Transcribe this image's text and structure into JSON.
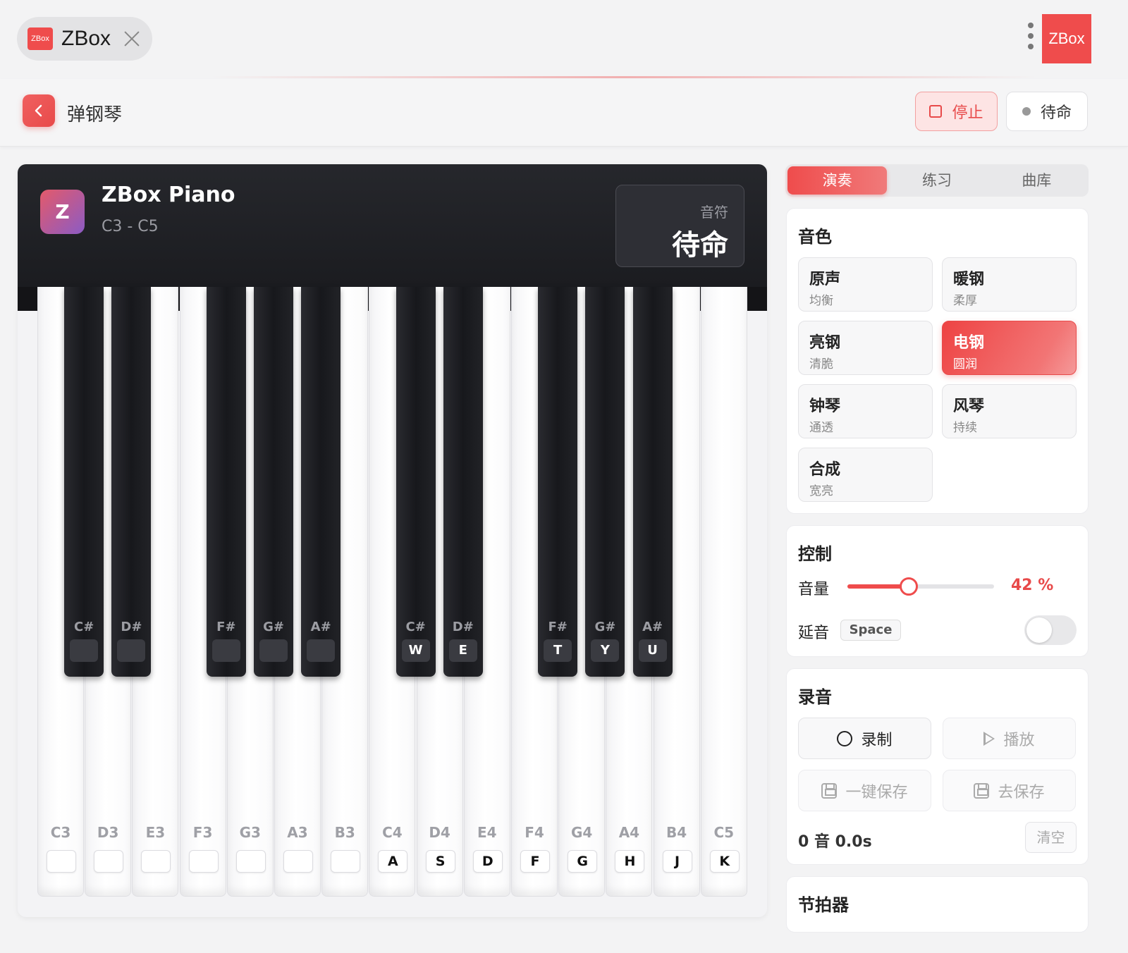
{
  "titlebar": {
    "tab_logo": "ZBox",
    "tab_title": "ZBox",
    "brand_button": "ZBox"
  },
  "header": {
    "title": "弹钢琴",
    "stop_label": "停止",
    "status_label": "待命"
  },
  "piano": {
    "name": "ZBox Piano",
    "range": "C3 - C5",
    "note_label": "音符",
    "note_value": "待命",
    "white_keys": [
      {
        "note": "C3",
        "key": ""
      },
      {
        "note": "D3",
        "key": ""
      },
      {
        "note": "E3",
        "key": ""
      },
      {
        "note": "F3",
        "key": ""
      },
      {
        "note": "G3",
        "key": ""
      },
      {
        "note": "A3",
        "key": ""
      },
      {
        "note": "B3",
        "key": ""
      },
      {
        "note": "C4",
        "key": "A"
      },
      {
        "note": "D4",
        "key": "S"
      },
      {
        "note": "E4",
        "key": "D"
      },
      {
        "note": "F4",
        "key": "F"
      },
      {
        "note": "G4",
        "key": "G"
      },
      {
        "note": "A4",
        "key": "H"
      },
      {
        "note": "B4",
        "key": "J"
      },
      {
        "note": "C5",
        "key": "K"
      }
    ],
    "black_keys": [
      {
        "note": "C#",
        "key": "",
        "after": 0
      },
      {
        "note": "D#",
        "key": "",
        "after": 1
      },
      {
        "note": "F#",
        "key": "",
        "after": 3
      },
      {
        "note": "G#",
        "key": "",
        "after": 4
      },
      {
        "note": "A#",
        "key": "",
        "after": 5
      },
      {
        "note": "C#",
        "key": "W",
        "after": 7
      },
      {
        "note": "D#",
        "key": "E",
        "after": 8
      },
      {
        "note": "F#",
        "key": "T",
        "after": 10
      },
      {
        "note": "G#",
        "key": "Y",
        "after": 11
      },
      {
        "note": "A#",
        "key": "U",
        "after": 12
      }
    ]
  },
  "tabs": [
    {
      "label": "演奏",
      "active": true
    },
    {
      "label": "练习",
      "active": false
    },
    {
      "label": "曲库",
      "active": false
    }
  ],
  "tone": {
    "title": "音色",
    "options": [
      {
        "name": "原声",
        "desc": "均衡",
        "active": false
      },
      {
        "name": "暖钢",
        "desc": "柔厚",
        "active": false
      },
      {
        "name": "亮钢",
        "desc": "清脆",
        "active": false
      },
      {
        "name": "电钢",
        "desc": "圆润",
        "active": true
      },
      {
        "name": "钟琴",
        "desc": "通透",
        "active": false
      },
      {
        "name": "风琴",
        "desc": "持续",
        "active": false
      },
      {
        "name": "合成",
        "desc": "宽亮",
        "active": false
      }
    ]
  },
  "control": {
    "title": "控制",
    "volume_label": "音量",
    "volume_value": "42 %",
    "volume_level": 0.42,
    "sustain_label": "延音",
    "sustain_key": "Space",
    "sustain_on": false
  },
  "recording": {
    "title": "录音",
    "record_label": "录制",
    "play_label": "播放",
    "quick_save_label": "一键保存",
    "go_save_label": "去保存",
    "stats": "0 音  0.0s",
    "clear_label": "清空"
  },
  "metronome": {
    "title": "节拍器"
  },
  "colors": {
    "accent": "#ef4c4c",
    "dark": "#1b1c20"
  }
}
